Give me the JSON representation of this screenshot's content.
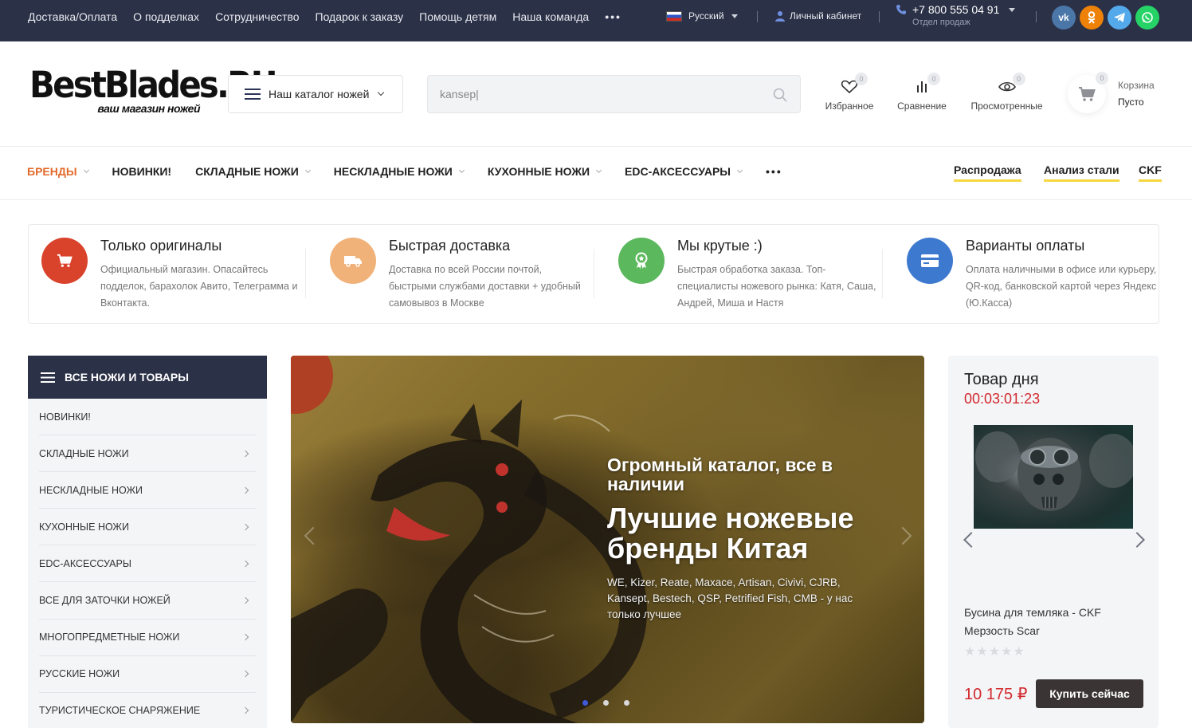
{
  "topbar": {
    "links": [
      "Доставка/Оплата",
      "О подделках",
      "Сотрудничество",
      "Подарок к заказу",
      "Помощь детям",
      "Наша команда"
    ],
    "more": "•••",
    "language": "Русский",
    "cabinet": "Личный кабинет",
    "phone": "+7 800 555 04 91",
    "phone_note": "Отдел продаж",
    "socials": [
      {
        "icon": "vk-icon",
        "glyph": "vk",
        "color": "#4a76a8"
      },
      {
        "icon": "odnoklassniki-icon",
        "glyph": "ok",
        "color": "#ee8208"
      },
      {
        "icon": "telegram-icon",
        "glyph": "➤",
        "color": "#54a9eb"
      },
      {
        "icon": "whatsapp-icon",
        "glyph": "✆",
        "color": "#25d366"
      }
    ]
  },
  "header": {
    "logo_main": "BestBlades.RU",
    "logo_tagline": "ваш магазин ножей",
    "catalog_button": "Наш каталог ножей",
    "search_value": "kansep|",
    "favorites": {
      "label": "Избранное",
      "count": "0"
    },
    "compare": {
      "label": "Сравнение",
      "count": "0"
    },
    "viewed": {
      "label": "Просмотренные",
      "count": "0"
    },
    "cart": {
      "label": "Корзина",
      "status": "Пусто",
      "count": "0"
    }
  },
  "mainnav": {
    "items": [
      {
        "label": "БРЕНДЫ",
        "dropdown": true,
        "active": true
      },
      {
        "label": "НОВИНКИ!",
        "dropdown": false
      },
      {
        "label": "СКЛАДНЫЕ НОЖИ",
        "dropdown": true
      },
      {
        "label": "НЕСКЛАДНЫЕ НОЖИ",
        "dropdown": true
      },
      {
        "label": "КУХОННЫЕ НОЖИ",
        "dropdown": true
      },
      {
        "label": "EDC-АКСЕССУАРЫ",
        "dropdown": true
      }
    ],
    "more": "•••",
    "right_links": [
      "Распродажа",
      "Анализ стали",
      "CKF"
    ],
    "accent_color": "#e26a2a"
  },
  "features": [
    {
      "title": "Только оригиналы",
      "text": "Официальный магазин. Опасайтесь подделок, барахолок Авито, Телеграмма и Вконтакта.",
      "icon": "cart-icon",
      "color": "#d9432b"
    },
    {
      "title": "Быстрая доставка",
      "text": "Доставка по всей России почтой, быстрыми службами доставки + удобный самовывоз в Москве",
      "icon": "truck-icon",
      "color": "#f1b27a"
    },
    {
      "title": "Мы крутые :)",
      "text": "Быстрая обработка заказа. Топ-специалисты ножевого рынка: Катя, Саша, Андрей, Миша и Настя",
      "icon": "award-icon",
      "color": "#5cb85c"
    },
    {
      "title": "Варианты оплаты",
      "text": "Оплата наличными в офисе или курьеру, QR-код, банковской картой через Яндекс (Ю.Касса)",
      "icon": "credit-card-icon",
      "color": "#3e79d0"
    }
  ],
  "sidebar": {
    "title": "ВСЕ НОЖИ И ТОВАРЫ",
    "items": [
      {
        "label": "НОВИНКИ!",
        "arrow": false
      },
      {
        "label": "СКЛАДНЫЕ НОЖИ",
        "arrow": true
      },
      {
        "label": "НЕСКЛАДНЫЕ НОЖИ",
        "arrow": true
      },
      {
        "label": "КУХОННЫЕ НОЖИ",
        "arrow": true
      },
      {
        "label": "EDC-АКСЕССУАРЫ",
        "arrow": true
      },
      {
        "label": "ВСЕ ДЛЯ ЗАТОЧКИ НОЖЕЙ",
        "arrow": true
      },
      {
        "label": "МНОГОПРЕДМЕТНЫЕ НОЖИ",
        "arrow": true
      },
      {
        "label": "РУССКИЕ НОЖИ",
        "arrow": true
      },
      {
        "label": "ТУРИСТИЧЕСКОЕ СНАРЯЖЕНИЕ",
        "arrow": true
      }
    ]
  },
  "banner": {
    "subtitle": "Огромный каталог, все в наличии",
    "title": "Лучшие ножевые бренды Китая",
    "text": "WE, Kizer, Reate, Maxace, Artisan, Civivi, CJRB, Kansept, Bestech, QSP, Petrified Fish, CMB - у нас только лучшее",
    "slides": 3,
    "active_slide": 1
  },
  "product_of_day": {
    "title": "Товар дня",
    "timer": "00:03:01:23",
    "name": "Бусина для темляка - CKF Мерзость Scar",
    "rating": 0,
    "max_rating": 5,
    "price": "10 175 ₽",
    "buy_button": "Купить сейчас"
  }
}
